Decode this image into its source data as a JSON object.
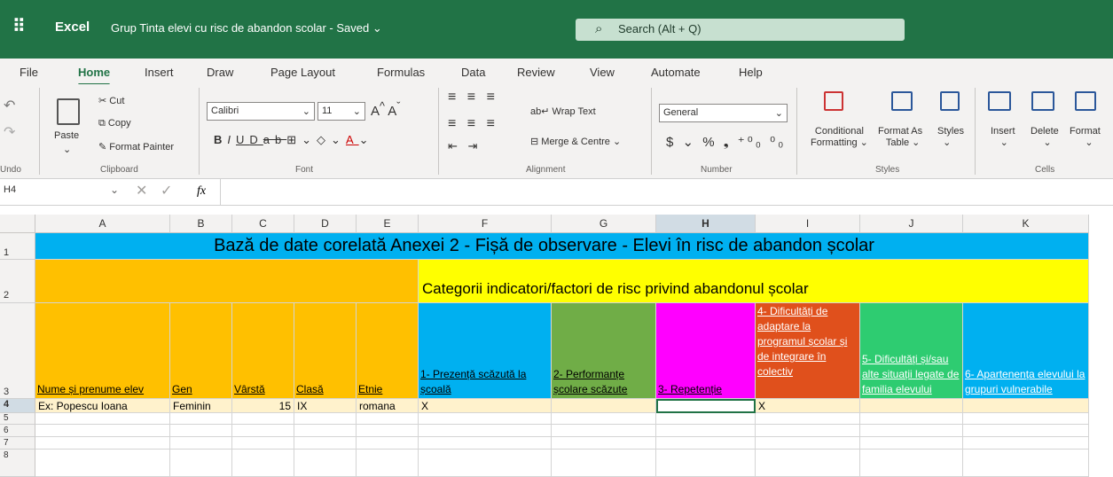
{
  "titlebar": {
    "app_name": "Excel",
    "doc_title": "Grup Tinta elevi cu risc de abandon scolar  -  Saved",
    "search_placeholder": "Search (Alt + Q)",
    "brand_color": "#217346"
  },
  "tabs": [
    "File",
    "Home",
    "Insert",
    "Draw",
    "Page Layout",
    "Formulas",
    "Data",
    "Review",
    "View",
    "Automate",
    "Help"
  ],
  "ribbon": {
    "undo_label": "Undo",
    "clipboard": {
      "paste": "Paste",
      "cut": "Cut",
      "copy": "Copy",
      "format_painter": "Format Painter",
      "label": "Clipboard"
    },
    "font": {
      "name": "Calibri",
      "size": "11",
      "label": "Font"
    },
    "alignment": {
      "wrap_text": "Wrap Text",
      "merge_centre": "Merge & Centre",
      "label": "Alignment"
    },
    "number": {
      "format": "General",
      "label": "Number"
    },
    "styles": {
      "conditional": "Conditional",
      "formatting": "Formatting",
      "format_as": "Format As",
      "table": "Table",
      "styles": "Styles",
      "label": "Styles"
    },
    "cells": {
      "insert": "Insert",
      "delete": "Delete",
      "format": "Format",
      "label": "Cells"
    }
  },
  "formula_bar": {
    "name_box": "H4",
    "fx": "fx",
    "value": ""
  },
  "sheet": {
    "columns": [
      "A",
      "B",
      "C",
      "D",
      "E",
      "F",
      "G",
      "H",
      "I",
      "J",
      "K"
    ],
    "rows": [
      "1",
      "2",
      "3",
      "4",
      "5",
      "6",
      "7",
      "8"
    ],
    "title": "Bază de date corelată Anexei 2 - Fișă de observare - Elevi în risc de abandon școlar",
    "subtitle": "Categorii indicatori/factori de risc privind abandonul școlar",
    "headers": [
      "Nume și prenume elev",
      "Gen",
      "Vârstă",
      "Clasă",
      "Etnie",
      "1- Prezență scăzută la școală",
      "2- Performanțe școlare scăzute",
      "3- Repetenție",
      "4- Dificultăți de adaptare la programul școlar și de integrare în colectiv",
      "5- Dificultăți și/sau alte situații legate de familia elevului",
      "6- Apartenența elevului la grupuri vulnerabile"
    ],
    "row4": [
      "Ex: Popescu Ioana",
      "Feminin",
      "15",
      "IX",
      "romana",
      "X",
      "",
      "",
      "X",
      "",
      ""
    ],
    "colors": {
      "blue": "#00b0f0",
      "yellow": "#ffff00",
      "orange": "#ffc000",
      "green": "#70ad47",
      "magenta": "#ff00ff",
      "red_orange": "#e0501c",
      "teal": "#2ecc71",
      "row4_bg": "#fff2cc"
    }
  }
}
